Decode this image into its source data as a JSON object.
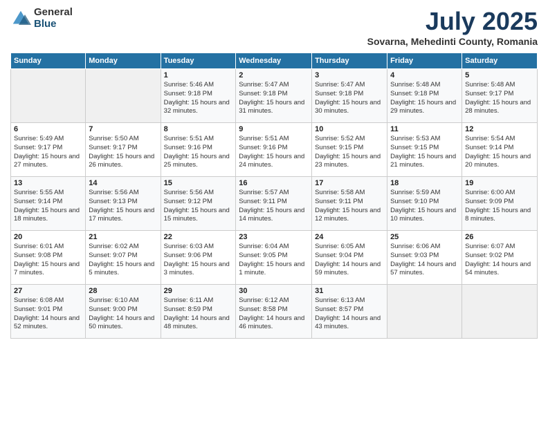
{
  "logo": {
    "general": "General",
    "blue": "Blue"
  },
  "title": "July 2025",
  "subtitle": "Sovarna, Mehedinti County, Romania",
  "headers": [
    "Sunday",
    "Monday",
    "Tuesday",
    "Wednesday",
    "Thursday",
    "Friday",
    "Saturday"
  ],
  "weeks": [
    [
      {
        "day": "",
        "sunrise": "",
        "sunset": "",
        "daylight": ""
      },
      {
        "day": "",
        "sunrise": "",
        "sunset": "",
        "daylight": ""
      },
      {
        "day": "1",
        "sunrise": "Sunrise: 5:46 AM",
        "sunset": "Sunset: 9:18 PM",
        "daylight": "Daylight: 15 hours and 32 minutes."
      },
      {
        "day": "2",
        "sunrise": "Sunrise: 5:47 AM",
        "sunset": "Sunset: 9:18 PM",
        "daylight": "Daylight: 15 hours and 31 minutes."
      },
      {
        "day": "3",
        "sunrise": "Sunrise: 5:47 AM",
        "sunset": "Sunset: 9:18 PM",
        "daylight": "Daylight: 15 hours and 30 minutes."
      },
      {
        "day": "4",
        "sunrise": "Sunrise: 5:48 AM",
        "sunset": "Sunset: 9:18 PM",
        "daylight": "Daylight: 15 hours and 29 minutes."
      },
      {
        "day": "5",
        "sunrise": "Sunrise: 5:48 AM",
        "sunset": "Sunset: 9:17 PM",
        "daylight": "Daylight: 15 hours and 28 minutes."
      }
    ],
    [
      {
        "day": "6",
        "sunrise": "Sunrise: 5:49 AM",
        "sunset": "Sunset: 9:17 PM",
        "daylight": "Daylight: 15 hours and 27 minutes."
      },
      {
        "day": "7",
        "sunrise": "Sunrise: 5:50 AM",
        "sunset": "Sunset: 9:17 PM",
        "daylight": "Daylight: 15 hours and 26 minutes."
      },
      {
        "day": "8",
        "sunrise": "Sunrise: 5:51 AM",
        "sunset": "Sunset: 9:16 PM",
        "daylight": "Daylight: 15 hours and 25 minutes."
      },
      {
        "day": "9",
        "sunrise": "Sunrise: 5:51 AM",
        "sunset": "Sunset: 9:16 PM",
        "daylight": "Daylight: 15 hours and 24 minutes."
      },
      {
        "day": "10",
        "sunrise": "Sunrise: 5:52 AM",
        "sunset": "Sunset: 9:15 PM",
        "daylight": "Daylight: 15 hours and 23 minutes."
      },
      {
        "day": "11",
        "sunrise": "Sunrise: 5:53 AM",
        "sunset": "Sunset: 9:15 PM",
        "daylight": "Daylight: 15 hours and 21 minutes."
      },
      {
        "day": "12",
        "sunrise": "Sunrise: 5:54 AM",
        "sunset": "Sunset: 9:14 PM",
        "daylight": "Daylight: 15 hours and 20 minutes."
      }
    ],
    [
      {
        "day": "13",
        "sunrise": "Sunrise: 5:55 AM",
        "sunset": "Sunset: 9:14 PM",
        "daylight": "Daylight: 15 hours and 18 minutes."
      },
      {
        "day": "14",
        "sunrise": "Sunrise: 5:56 AM",
        "sunset": "Sunset: 9:13 PM",
        "daylight": "Daylight: 15 hours and 17 minutes."
      },
      {
        "day": "15",
        "sunrise": "Sunrise: 5:56 AM",
        "sunset": "Sunset: 9:12 PM",
        "daylight": "Daylight: 15 hours and 15 minutes."
      },
      {
        "day": "16",
        "sunrise": "Sunrise: 5:57 AM",
        "sunset": "Sunset: 9:11 PM",
        "daylight": "Daylight: 15 hours and 14 minutes."
      },
      {
        "day": "17",
        "sunrise": "Sunrise: 5:58 AM",
        "sunset": "Sunset: 9:11 PM",
        "daylight": "Daylight: 15 hours and 12 minutes."
      },
      {
        "day": "18",
        "sunrise": "Sunrise: 5:59 AM",
        "sunset": "Sunset: 9:10 PM",
        "daylight": "Daylight: 15 hours and 10 minutes."
      },
      {
        "day": "19",
        "sunrise": "Sunrise: 6:00 AM",
        "sunset": "Sunset: 9:09 PM",
        "daylight": "Daylight: 15 hours and 8 minutes."
      }
    ],
    [
      {
        "day": "20",
        "sunrise": "Sunrise: 6:01 AM",
        "sunset": "Sunset: 9:08 PM",
        "daylight": "Daylight: 15 hours and 7 minutes."
      },
      {
        "day": "21",
        "sunrise": "Sunrise: 6:02 AM",
        "sunset": "Sunset: 9:07 PM",
        "daylight": "Daylight: 15 hours and 5 minutes."
      },
      {
        "day": "22",
        "sunrise": "Sunrise: 6:03 AM",
        "sunset": "Sunset: 9:06 PM",
        "daylight": "Daylight: 15 hours and 3 minutes."
      },
      {
        "day": "23",
        "sunrise": "Sunrise: 6:04 AM",
        "sunset": "Sunset: 9:05 PM",
        "daylight": "Daylight: 15 hours and 1 minute."
      },
      {
        "day": "24",
        "sunrise": "Sunrise: 6:05 AM",
        "sunset": "Sunset: 9:04 PM",
        "daylight": "Daylight: 14 hours and 59 minutes."
      },
      {
        "day": "25",
        "sunrise": "Sunrise: 6:06 AM",
        "sunset": "Sunset: 9:03 PM",
        "daylight": "Daylight: 14 hours and 57 minutes."
      },
      {
        "day": "26",
        "sunrise": "Sunrise: 6:07 AM",
        "sunset": "Sunset: 9:02 PM",
        "daylight": "Daylight: 14 hours and 54 minutes."
      }
    ],
    [
      {
        "day": "27",
        "sunrise": "Sunrise: 6:08 AM",
        "sunset": "Sunset: 9:01 PM",
        "daylight": "Daylight: 14 hours and 52 minutes."
      },
      {
        "day": "28",
        "sunrise": "Sunrise: 6:10 AM",
        "sunset": "Sunset: 9:00 PM",
        "daylight": "Daylight: 14 hours and 50 minutes."
      },
      {
        "day": "29",
        "sunrise": "Sunrise: 6:11 AM",
        "sunset": "Sunset: 8:59 PM",
        "daylight": "Daylight: 14 hours and 48 minutes."
      },
      {
        "day": "30",
        "sunrise": "Sunrise: 6:12 AM",
        "sunset": "Sunset: 8:58 PM",
        "daylight": "Daylight: 14 hours and 46 minutes."
      },
      {
        "day": "31",
        "sunrise": "Sunrise: 6:13 AM",
        "sunset": "Sunset: 8:57 PM",
        "daylight": "Daylight: 14 hours and 43 minutes."
      },
      {
        "day": "",
        "sunrise": "",
        "sunset": "",
        "daylight": ""
      },
      {
        "day": "",
        "sunrise": "",
        "sunset": "",
        "daylight": ""
      }
    ]
  ]
}
